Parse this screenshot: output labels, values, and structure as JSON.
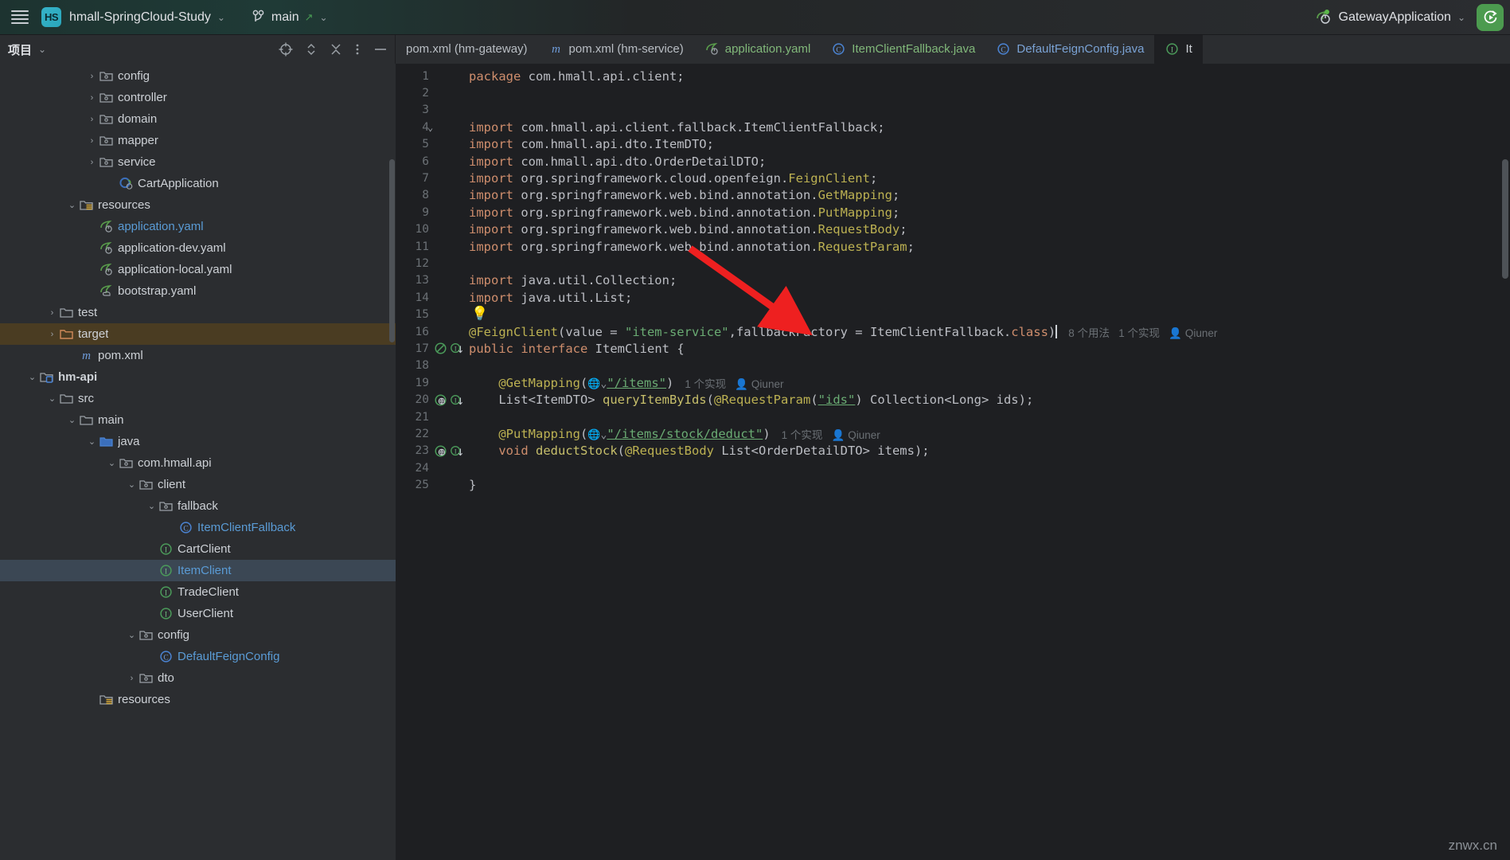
{
  "titlebar": {
    "menu_icon": "hamburger-icon",
    "project_badge": "HS",
    "project_name": "hmall-SpringCloud-Study",
    "project_chevron": "⌄",
    "branch_icon": "git-branch-icon",
    "branch_name": "main",
    "branch_push_arrow": "↗",
    "branch_chevron": "⌄",
    "run_config_icon": "spring-boot-icon",
    "run_config_name": "GatewayApplication",
    "run_config_chevron": "⌄",
    "rerun_icon": "rerun-icon"
  },
  "project_panel": {
    "title": "项目",
    "title_chevron": "⌄",
    "icons": [
      "locate-target-icon",
      "expand-collapse-icon",
      "collapse-all-icon",
      "more-options-icon",
      "hide-panel-icon"
    ]
  },
  "editor_tabs": [
    {
      "label": "pom.xml (hm-gateway)",
      "icon": "none",
      "color": "#b9bec4",
      "active": false
    },
    {
      "label": "pom.xml (hm-service)",
      "icon": "maven-m-icon",
      "color": "#b9bec4",
      "active": false
    },
    {
      "label": "application.yaml",
      "icon": "spring-leaf-icon",
      "color": "#81b87a",
      "active": false
    },
    {
      "label": "ItemClientFallback.java",
      "icon": "class-c-icon",
      "color": "#81b87a",
      "active": false
    },
    {
      "label": "DefaultFeignConfig.java",
      "icon": "class-c-icon",
      "color": "#7aa2d4",
      "active": false
    },
    {
      "label": "It",
      "icon": "interface-i-icon",
      "color": "#cdd1d6",
      "active": true
    }
  ],
  "tree": [
    {
      "indent": 4,
      "arrow": "›",
      "icon": "package-folder-icon",
      "label": "config",
      "color": "#cdd1d6"
    },
    {
      "indent": 4,
      "arrow": "›",
      "icon": "package-folder-icon",
      "label": "controller",
      "color": "#cdd1d6"
    },
    {
      "indent": 4,
      "arrow": "›",
      "icon": "package-folder-icon",
      "label": "domain",
      "color": "#cdd1d6"
    },
    {
      "indent": 4,
      "arrow": "›",
      "icon": "package-folder-icon",
      "label": "mapper",
      "color": "#cdd1d6"
    },
    {
      "indent": 4,
      "arrow": "›",
      "icon": "package-folder-icon",
      "label": "service",
      "color": "#cdd1d6"
    },
    {
      "indent": 5,
      "arrow": "",
      "icon": "spring-class-icon",
      "label": "CartApplication",
      "color": "#cdd1d6"
    },
    {
      "indent": 3,
      "arrow": "⌄",
      "icon": "resources-folder-icon",
      "label": "resources",
      "color": "#cdd1d6"
    },
    {
      "indent": 4,
      "arrow": "",
      "icon": "spring-yaml-icon",
      "label": "application.yaml",
      "color": "#5a9bd5"
    },
    {
      "indent": 4,
      "arrow": "",
      "icon": "spring-yaml-icon",
      "label": "application-dev.yaml",
      "color": "#cdd1d6"
    },
    {
      "indent": 4,
      "arrow": "",
      "icon": "spring-yaml-icon",
      "label": "application-local.yaml",
      "color": "#cdd1d6"
    },
    {
      "indent": 4,
      "arrow": "",
      "icon": "spring-cloud-yaml-icon",
      "label": "bootstrap.yaml",
      "color": "#cdd1d6"
    },
    {
      "indent": 2,
      "arrow": "›",
      "icon": "folder-icon",
      "label": "test",
      "color": "#cdd1d6"
    },
    {
      "indent": 2,
      "arrow": "›",
      "icon": "excluded-folder-icon",
      "label": "target",
      "color": "#cdd1d6",
      "state": "excluded"
    },
    {
      "indent": 3,
      "arrow": "",
      "icon": "maven-m-icon",
      "label": "pom.xml",
      "color": "#cdd1d6"
    },
    {
      "indent": 1,
      "arrow": "⌄",
      "icon": "module-folder-icon",
      "label": "hm-api",
      "color": "#cdd1d6",
      "bold": true
    },
    {
      "indent": 2,
      "arrow": "⌄",
      "icon": "folder-icon",
      "label": "src",
      "color": "#cdd1d6"
    },
    {
      "indent": 3,
      "arrow": "⌄",
      "icon": "folder-icon",
      "label": "main",
      "color": "#cdd1d6"
    },
    {
      "indent": 4,
      "arrow": "⌄",
      "icon": "sources-folder-icon",
      "label": "java",
      "color": "#cdd1d6"
    },
    {
      "indent": 5,
      "arrow": "⌄",
      "icon": "package-folder-icon",
      "label": "com.hmall.api",
      "color": "#cdd1d6"
    },
    {
      "indent": 6,
      "arrow": "⌄",
      "icon": "package-folder-icon",
      "label": "client",
      "color": "#cdd1d6"
    },
    {
      "indent": 7,
      "arrow": "⌄",
      "icon": "package-folder-icon",
      "label": "fallback",
      "color": "#cdd1d6"
    },
    {
      "indent": 8,
      "arrow": "",
      "icon": "class-c-icon",
      "label": "ItemClientFallback",
      "color": "#5a9bd5"
    },
    {
      "indent": 7,
      "arrow": "",
      "icon": "interface-i-icon",
      "label": "CartClient",
      "color": "#cdd1d6"
    },
    {
      "indent": 7,
      "arrow": "",
      "icon": "interface-i-icon",
      "label": "ItemClient",
      "color": "#5a9bd5",
      "state": "selected"
    },
    {
      "indent": 7,
      "arrow": "",
      "icon": "interface-i-icon",
      "label": "TradeClient",
      "color": "#cdd1d6"
    },
    {
      "indent": 7,
      "arrow": "",
      "icon": "interface-i-icon",
      "label": "UserClient",
      "color": "#cdd1d6"
    },
    {
      "indent": 6,
      "arrow": "⌄",
      "icon": "package-folder-icon",
      "label": "config",
      "color": "#cdd1d6"
    },
    {
      "indent": 7,
      "arrow": "",
      "icon": "class-c-icon",
      "label": "DefaultFeignConfig",
      "color": "#5a9bd5"
    },
    {
      "indent": 6,
      "arrow": "›",
      "icon": "package-folder-icon",
      "label": "dto",
      "color": "#cdd1d6"
    },
    {
      "indent": 4,
      "arrow": "",
      "icon": "resources-folder-icon",
      "label": "resources",
      "color": "#cdd1d6"
    }
  ],
  "code": {
    "file_name": "ItemClient.java",
    "lines": [
      {
        "n": 1,
        "text": "package com.hmall.api.client;"
      },
      {
        "n": 2,
        "text": ""
      },
      {
        "n": 3,
        "text": ""
      },
      {
        "n": 4,
        "text": "import com.hmall.api.client.fallback.ItemClientFallback;",
        "fold": "⌄"
      },
      {
        "n": 5,
        "text": "import com.hmall.api.dto.ItemDTO;"
      },
      {
        "n": 6,
        "text": "import com.hmall.api.dto.OrderDetailDTO;"
      },
      {
        "n": 7,
        "text": "import org.springframework.cloud.openfeign.FeignClient;"
      },
      {
        "n": 8,
        "text": "import org.springframework.web.bind.annotation.GetMapping;"
      },
      {
        "n": 9,
        "text": "import org.springframework.web.bind.annotation.PutMapping;"
      },
      {
        "n": 10,
        "text": "import org.springframework.web.bind.annotation.RequestBody;"
      },
      {
        "n": 11,
        "text": "import org.springframework.web.bind.annotation.RequestParam;"
      },
      {
        "n": 12,
        "text": ""
      },
      {
        "n": 13,
        "text": "import java.util.Collection;"
      },
      {
        "n": 14,
        "text": "import java.util.List;"
      },
      {
        "n": 15,
        "text": ""
      },
      {
        "n": 16,
        "text": "@FeignClient(value = \"item-service\",fallbackFactory = ItemClientFallback.class)"
      },
      {
        "n": 17,
        "text": "public interface ItemClient {"
      },
      {
        "n": 18,
        "text": ""
      },
      {
        "n": 19,
        "text": "    @GetMapping(\"/items\")"
      },
      {
        "n": 20,
        "text": "    List<ItemDTO> queryItemByIds(@RequestParam(\"ids\") Collection<Long> ids);"
      },
      {
        "n": 21,
        "text": ""
      },
      {
        "n": 22,
        "text": "    @PutMapping(\"/items/stock/deduct\")"
      },
      {
        "n": 23,
        "text": "    void deductStock(@RequestBody List<OrderDetailDTO> items);"
      },
      {
        "n": 24,
        "text": ""
      },
      {
        "n": 25,
        "text": "}"
      }
    ],
    "inlay_hints": {
      "line16_usages": "8 个用法",
      "line16_implementations": "1 个实现",
      "line16_author": "Qiuner",
      "line19_implementations": "1 个实现",
      "line19_author": "Qiuner",
      "line22_implementations": "1 个实现",
      "line22_author": "Qiuner"
    },
    "gutter": {
      "line17": [
        "spring-bean-icon",
        "implemented-by-icon"
      ],
      "line20": [
        "spring-endpoint-icon",
        "implemented-by-icon"
      ],
      "line23": [
        "spring-endpoint-icon",
        "implemented-by-icon"
      ],
      "line15_bulb": "intention-bulb-icon"
    },
    "url_mapping_line19": "/items",
    "url_mapping_line22": "/items/stock/deduct"
  },
  "annotation_overlay": {
    "type": "red-arrow",
    "color": "#ee2020"
  },
  "watermark": "znwx.cn"
}
